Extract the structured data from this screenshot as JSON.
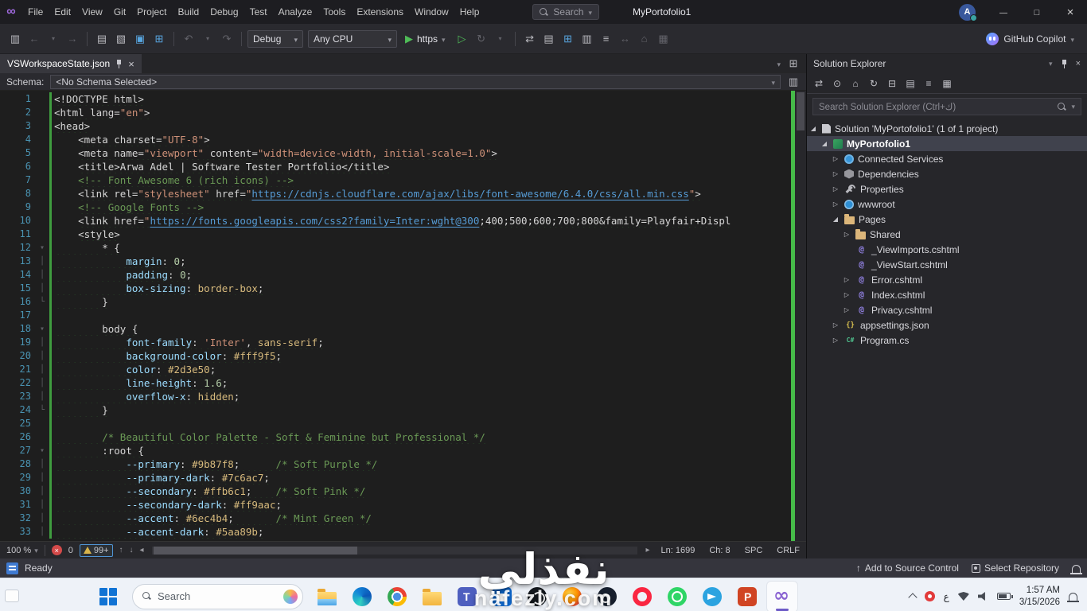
{
  "titlebar": {
    "menus": [
      "File",
      "Edit",
      "View",
      "Git",
      "Project",
      "Build",
      "Debug",
      "Test",
      "Analyze",
      "Tools",
      "Extensions",
      "Window",
      "Help"
    ],
    "search_label": "Search",
    "window_title": "MyPortofolio1",
    "avatar_initial": "A"
  },
  "toolbar": {
    "config_label": "Debug",
    "platform_label": "Any CPU",
    "run_label": "https",
    "copilot_label": "GitHub Copilot"
  },
  "editor": {
    "tab_label": "VSWorkspaceState.json",
    "schema_label": "Schema:",
    "schema_value": "<No Schema Selected>",
    "status": {
      "zoom": "100 %",
      "errors": "0",
      "warnings": "99+",
      "line": "Ln: 1699",
      "column": "Ch: 8",
      "spaces": "SPC",
      "eol": "CRLF"
    },
    "lines": [
      {
        "f": "",
        "s": [
          [
            "x",
            "<!DOCTYPE html>"
          ]
        ]
      },
      {
        "f": "",
        "s": [
          [
            "x",
            "<html lang="
          ],
          [
            "s",
            "\"en\""
          ],
          [
            "x",
            ">"
          ]
        ]
      },
      {
        "f": "",
        "s": [
          [
            "x",
            "<head>"
          ]
        ]
      },
      {
        "f": "",
        "s": [
          [
            "p",
            "    "
          ],
          [
            "x",
            "<meta charset="
          ],
          [
            "s",
            "\"UTF-8\""
          ],
          [
            "x",
            ">"
          ]
        ]
      },
      {
        "f": "",
        "s": [
          [
            "p",
            "    "
          ],
          [
            "x",
            "<meta name="
          ],
          [
            "s",
            "\"viewport\""
          ],
          [
            "x",
            " content="
          ],
          [
            "s",
            "\"width=device-width, initial-scale=1.0\""
          ],
          [
            "x",
            ">"
          ]
        ]
      },
      {
        "f": "",
        "s": [
          [
            "p",
            "    "
          ],
          [
            "x",
            "<title>Arwa Adel | Software Tester Portfolio</title>"
          ]
        ]
      },
      {
        "f": "",
        "s": [
          [
            "p",
            "    "
          ],
          [
            "c",
            "<!-- Font Awesome 6 (rich icons) -->"
          ]
        ]
      },
      {
        "f": "",
        "s": [
          [
            "p",
            "    "
          ],
          [
            "x",
            "<link rel="
          ],
          [
            "s",
            "\"stylesheet\""
          ],
          [
            "x",
            " href="
          ],
          [
            "s",
            "\""
          ],
          [
            "u",
            "https://cdnjs.cloudflare.com/ajax/libs/font-awesome/6.4.0/css/all.min.css"
          ],
          [
            "s",
            "\""
          ],
          [
            "x",
            ">"
          ]
        ]
      },
      {
        "f": "",
        "s": [
          [
            "p",
            "    "
          ],
          [
            "c",
            "<!-- Google Fonts -->"
          ]
        ]
      },
      {
        "f": "",
        "s": [
          [
            "p",
            "    "
          ],
          [
            "x",
            "<link href="
          ],
          [
            "s",
            "\""
          ],
          [
            "u",
            "https://fonts.googleapis.com/css2?family=Inter:wght@300"
          ],
          [
            "x",
            ";400;500;600;700;800&family=Playfair+Displ"
          ]
        ]
      },
      {
        "f": "",
        "s": [
          [
            "p",
            "    "
          ],
          [
            "x",
            "<style>"
          ]
        ]
      },
      {
        "f": "start",
        "s": [
          [
            "w",
            "        "
          ],
          [
            "x",
            "* {"
          ]
        ]
      },
      {
        "f": "mid",
        "s": [
          [
            "w",
            "            "
          ],
          [
            "a",
            "margin"
          ],
          [
            "x",
            ": "
          ],
          [
            "n",
            "0"
          ],
          [
            "x",
            ";"
          ]
        ]
      },
      {
        "f": "mid",
        "s": [
          [
            "w",
            "            "
          ],
          [
            "a",
            "padding"
          ],
          [
            "x",
            ": "
          ],
          [
            "n",
            "0"
          ],
          [
            "x",
            ";"
          ]
        ]
      },
      {
        "f": "mid",
        "s": [
          [
            "w",
            "            "
          ],
          [
            "a",
            "box-sizing"
          ],
          [
            "x",
            ": "
          ],
          [
            "v",
            "border-box"
          ],
          [
            "x",
            ";"
          ]
        ]
      },
      {
        "f": "end",
        "s": [
          [
            "w",
            "        "
          ],
          [
            "x",
            "}"
          ]
        ]
      },
      {
        "f": "",
        "s": []
      },
      {
        "f": "start",
        "s": [
          [
            "w",
            "        "
          ],
          [
            "x",
            "body {"
          ]
        ]
      },
      {
        "f": "mid",
        "s": [
          [
            "w",
            "            "
          ],
          [
            "a",
            "font-family"
          ],
          [
            "x",
            ": "
          ],
          [
            "s",
            "'Inter'"
          ],
          [
            "x",
            ", "
          ],
          [
            "v",
            "sans-serif"
          ],
          [
            "x",
            ";"
          ]
        ]
      },
      {
        "f": "mid",
        "s": [
          [
            "w",
            "            "
          ],
          [
            "a",
            "background-color"
          ],
          [
            "x",
            ": "
          ],
          [
            "v",
            "#fff9f5"
          ],
          [
            "x",
            ";"
          ]
        ]
      },
      {
        "f": "mid",
        "s": [
          [
            "w",
            "            "
          ],
          [
            "a",
            "color"
          ],
          [
            "x",
            ": "
          ],
          [
            "v",
            "#2d3e50"
          ],
          [
            "x",
            ";"
          ]
        ]
      },
      {
        "f": "mid",
        "s": [
          [
            "w",
            "            "
          ],
          [
            "a",
            "line-height"
          ],
          [
            "x",
            ": "
          ],
          [
            "n",
            "1.6"
          ],
          [
            "x",
            ";"
          ]
        ]
      },
      {
        "f": "mid",
        "s": [
          [
            "w",
            "            "
          ],
          [
            "a",
            "overflow-x"
          ],
          [
            "x",
            ": "
          ],
          [
            "v",
            "hidden"
          ],
          [
            "x",
            ";"
          ]
        ]
      },
      {
        "f": "end",
        "s": [
          [
            "w",
            "        "
          ],
          [
            "x",
            "}"
          ]
        ]
      },
      {
        "f": "",
        "s": []
      },
      {
        "f": "",
        "s": [
          [
            "w",
            "        "
          ],
          [
            "c",
            "/* Beautiful Color Palette - Soft & Feminine but Professional */"
          ]
        ]
      },
      {
        "f": "start",
        "s": [
          [
            "w",
            "        "
          ],
          [
            "x",
            ":root {"
          ]
        ]
      },
      {
        "f": "mid",
        "s": [
          [
            "w",
            "            "
          ],
          [
            "a",
            "--primary"
          ],
          [
            "x",
            ": "
          ],
          [
            "v",
            "#9b87f8"
          ],
          [
            "x",
            ";      "
          ],
          [
            "c",
            "/* Soft Purple */"
          ]
        ]
      },
      {
        "f": "mid",
        "s": [
          [
            "w",
            "            "
          ],
          [
            "a",
            "--primary-dark"
          ],
          [
            "x",
            ": "
          ],
          [
            "v",
            "#7c6ac7"
          ],
          [
            "x",
            ";"
          ]
        ]
      },
      {
        "f": "mid",
        "s": [
          [
            "w",
            "            "
          ],
          [
            "a",
            "--secondary"
          ],
          [
            "x",
            ": "
          ],
          [
            "v",
            "#ffb6c1"
          ],
          [
            "x",
            ";    "
          ],
          [
            "c",
            "/* Soft Pink */"
          ]
        ]
      },
      {
        "f": "mid",
        "s": [
          [
            "w",
            "            "
          ],
          [
            "a",
            "--secondary-dark"
          ],
          [
            "x",
            ": "
          ],
          [
            "v",
            "#ff9aac"
          ],
          [
            "x",
            ";"
          ]
        ]
      },
      {
        "f": "mid",
        "s": [
          [
            "w",
            "            "
          ],
          [
            "a",
            "--accent"
          ],
          [
            "x",
            ": "
          ],
          [
            "v",
            "#6ec4b4"
          ],
          [
            "x",
            ";       "
          ],
          [
            "c",
            "/* Mint Green */"
          ]
        ]
      },
      {
        "f": "mid",
        "s": [
          [
            "w",
            "            "
          ],
          [
            "a",
            "--accent-dark"
          ],
          [
            "x",
            ": "
          ],
          [
            "v",
            "#5aa89b"
          ],
          [
            "x",
            ";"
          ]
        ]
      }
    ]
  },
  "solution_explorer": {
    "title": "Solution Explorer",
    "search_placeholder": "Search Solution Explorer (Ctrl+ك)",
    "items": [
      {
        "indent": 0,
        "arrow": "exp",
        "icon": "solution",
        "label": "Solution 'MyPortofolio1' (1 of 1 project)",
        "selected": false
      },
      {
        "indent": 1,
        "arrow": "exp",
        "icon": "project",
        "label": "MyPortofolio1",
        "selected": true
      },
      {
        "indent": 2,
        "arrow": "col",
        "icon": "services",
        "label": "Connected Services",
        "selected": false
      },
      {
        "indent": 2,
        "arrow": "col",
        "icon": "dependencies",
        "label": "Dependencies",
        "selected": false
      },
      {
        "indent": 2,
        "arrow": "col",
        "icon": "properties",
        "label": "Properties",
        "selected": false
      },
      {
        "indent": 2,
        "arrow": "col",
        "icon": "wwwroot",
        "label": "wwwroot",
        "selected": false
      },
      {
        "indent": 2,
        "arrow": "exp",
        "icon": "folder",
        "label": "Pages",
        "selected": false
      },
      {
        "indent": 3,
        "arrow": "col",
        "icon": "folder",
        "label": "Shared",
        "selected": false
      },
      {
        "indent": 3,
        "arrow": "none",
        "icon": "razor",
        "label": "_ViewImports.cshtml",
        "selected": false
      },
      {
        "indent": 3,
        "arrow": "none",
        "icon": "razor",
        "label": "_ViewStart.cshtml",
        "selected": false
      },
      {
        "indent": 3,
        "arrow": "col",
        "icon": "razor",
        "label": "Error.cshtml",
        "selected": false
      },
      {
        "indent": 3,
        "arrow": "col",
        "icon": "razor",
        "label": "Index.cshtml",
        "selected": false
      },
      {
        "indent": 3,
        "arrow": "col",
        "icon": "razor",
        "label": "Privacy.cshtml",
        "selected": false
      },
      {
        "indent": 2,
        "arrow": "col",
        "icon": "json",
        "label": "appsettings.json",
        "selected": false
      },
      {
        "indent": 2,
        "arrow": "col",
        "icon": "cs",
        "label": "Program.cs",
        "selected": false
      }
    ]
  },
  "statusbar": {
    "ready": "Ready",
    "add_source_control": "Add to Source Control",
    "select_repository": "Select Repository"
  },
  "taskbar": {
    "search_placeholder": "Search",
    "apps": [
      {
        "id": "file-explorer",
        "active": false
      },
      {
        "id": "edge",
        "active": false
      },
      {
        "id": "chrome",
        "active": false
      },
      {
        "id": "folder",
        "active": false
      },
      {
        "id": "teams",
        "active": false
      },
      {
        "id": "store",
        "active": false
      },
      {
        "id": "obs",
        "active": false
      },
      {
        "id": "firefox",
        "active": false
      },
      {
        "id": "steam",
        "active": false
      },
      {
        "id": "opera",
        "active": false
      },
      {
        "id": "whatsapp",
        "active": false
      },
      {
        "id": "telegram",
        "active": false
      },
      {
        "id": "powerpoint",
        "active": false
      },
      {
        "id": "visual-studio",
        "active": true
      }
    ],
    "tray": {
      "language": "ع",
      "time": "1:57 AM",
      "date": "3/15/2026"
    }
  },
  "watermark": {
    "title": "نفذلي",
    "site": "nafezly.com"
  }
}
